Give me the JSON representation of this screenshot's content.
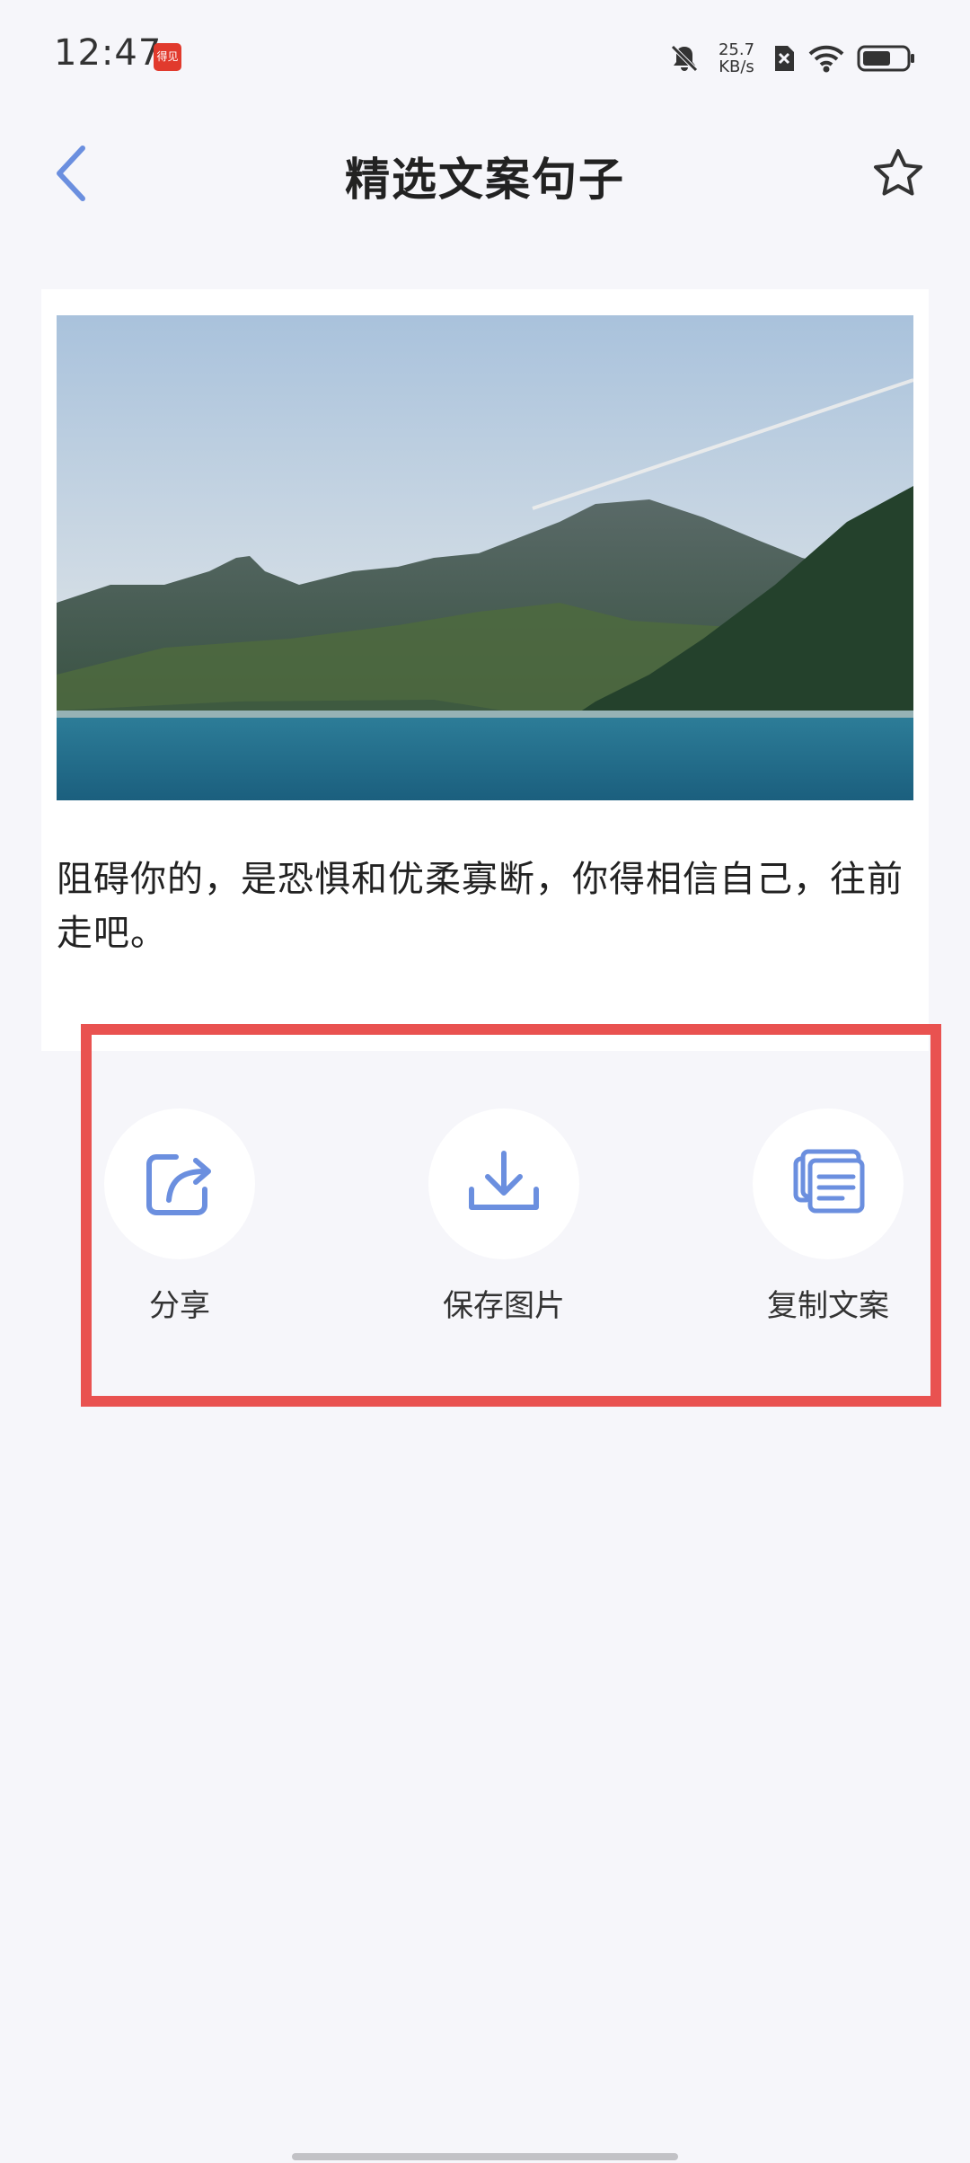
{
  "status_bar": {
    "time": "12:47",
    "app_badge": "得见",
    "net_speed_value": "25.7",
    "net_speed_unit": "KB/s",
    "icons": [
      "mute-icon",
      "network-speed",
      "sim-x-icon",
      "wifi-icon",
      "battery-icon"
    ]
  },
  "header": {
    "title": "精选文案句子",
    "back_icon": "chevron-left-icon",
    "favorite_icon": "star-outline-icon"
  },
  "card": {
    "image_subject": "mountain-lake-landscape",
    "quote": "阻碍你的，是恐惧和优柔寡断，你得相信自己，往前走吧。"
  },
  "actions": [
    {
      "label": "分享",
      "icon": "share-icon"
    },
    {
      "label": "保存图片",
      "icon": "download-icon"
    },
    {
      "label": "复制文案",
      "icon": "copy-text-icon"
    }
  ],
  "colors": {
    "accent": "#6b8fdf",
    "background": "#f6f6fa",
    "highlight": "#e95250"
  }
}
